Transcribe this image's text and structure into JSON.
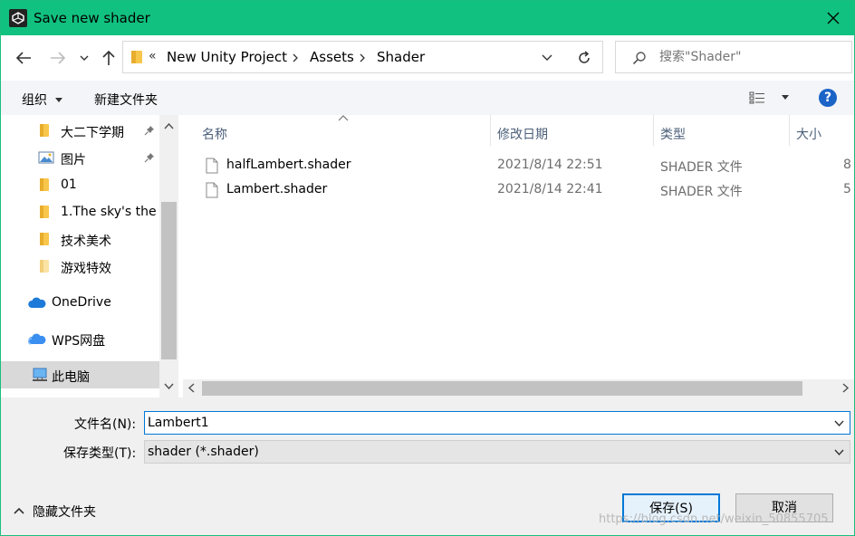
{
  "window": {
    "title": "Save new shader"
  },
  "address": {
    "overflow": "«",
    "segments": [
      "New Unity Project",
      "Assets",
      "Shader"
    ]
  },
  "search": {
    "placeholder": "搜索\"Shader\""
  },
  "toolbar": {
    "organize": "组织",
    "new_folder": "新建文件夹",
    "help": "?"
  },
  "nav_pane": {
    "items": [
      {
        "label": "大二下学期",
        "icon": "folder-icon",
        "pinned": true
      },
      {
        "label": "图片",
        "icon": "pictures-icon",
        "pinned": true
      },
      {
        "label": "01",
        "icon": "folder-icon",
        "pinned": false
      },
      {
        "label": "1.The sky's the",
        "icon": "folder-icon",
        "pinned": false
      },
      {
        "label": "技术美术",
        "icon": "folder-icon",
        "pinned": false
      },
      {
        "label": "游戏特效",
        "icon": "folder-icon",
        "pinned": false
      },
      {
        "label": "OneDrive",
        "icon": "cloud-icon",
        "pinned": false
      },
      {
        "label": "WPS网盘",
        "icon": "cloud-icon",
        "pinned": false
      },
      {
        "label": "此电脑",
        "icon": "computer-icon",
        "pinned": false,
        "selected": true
      }
    ]
  },
  "columns": {
    "name": "名称",
    "date": "修改日期",
    "type": "类型",
    "size": "大小"
  },
  "files": [
    {
      "name": "halfLambert.shader",
      "date": "2021/8/14 22:51",
      "type": "SHADER 文件",
      "size": "8"
    },
    {
      "name": "Lambert.shader",
      "date": "2021/8/14 22:41",
      "type": "SHADER 文件",
      "size": "5"
    }
  ],
  "form": {
    "filename_label": "文件名(N):",
    "filename_value": "Lambert1",
    "filetype_label": "保存类型(T):",
    "filetype_value": "shader (*.shader)"
  },
  "footer": {
    "hide_folders": "隐藏文件夹",
    "save": "保存(S)",
    "cancel": "取消",
    "watermark": "https://blog.csdn.net/weixin_50855705"
  },
  "colors": {
    "titlebar": "#11c17f",
    "accent": "#0078d7",
    "folder": "#f8c64a"
  }
}
